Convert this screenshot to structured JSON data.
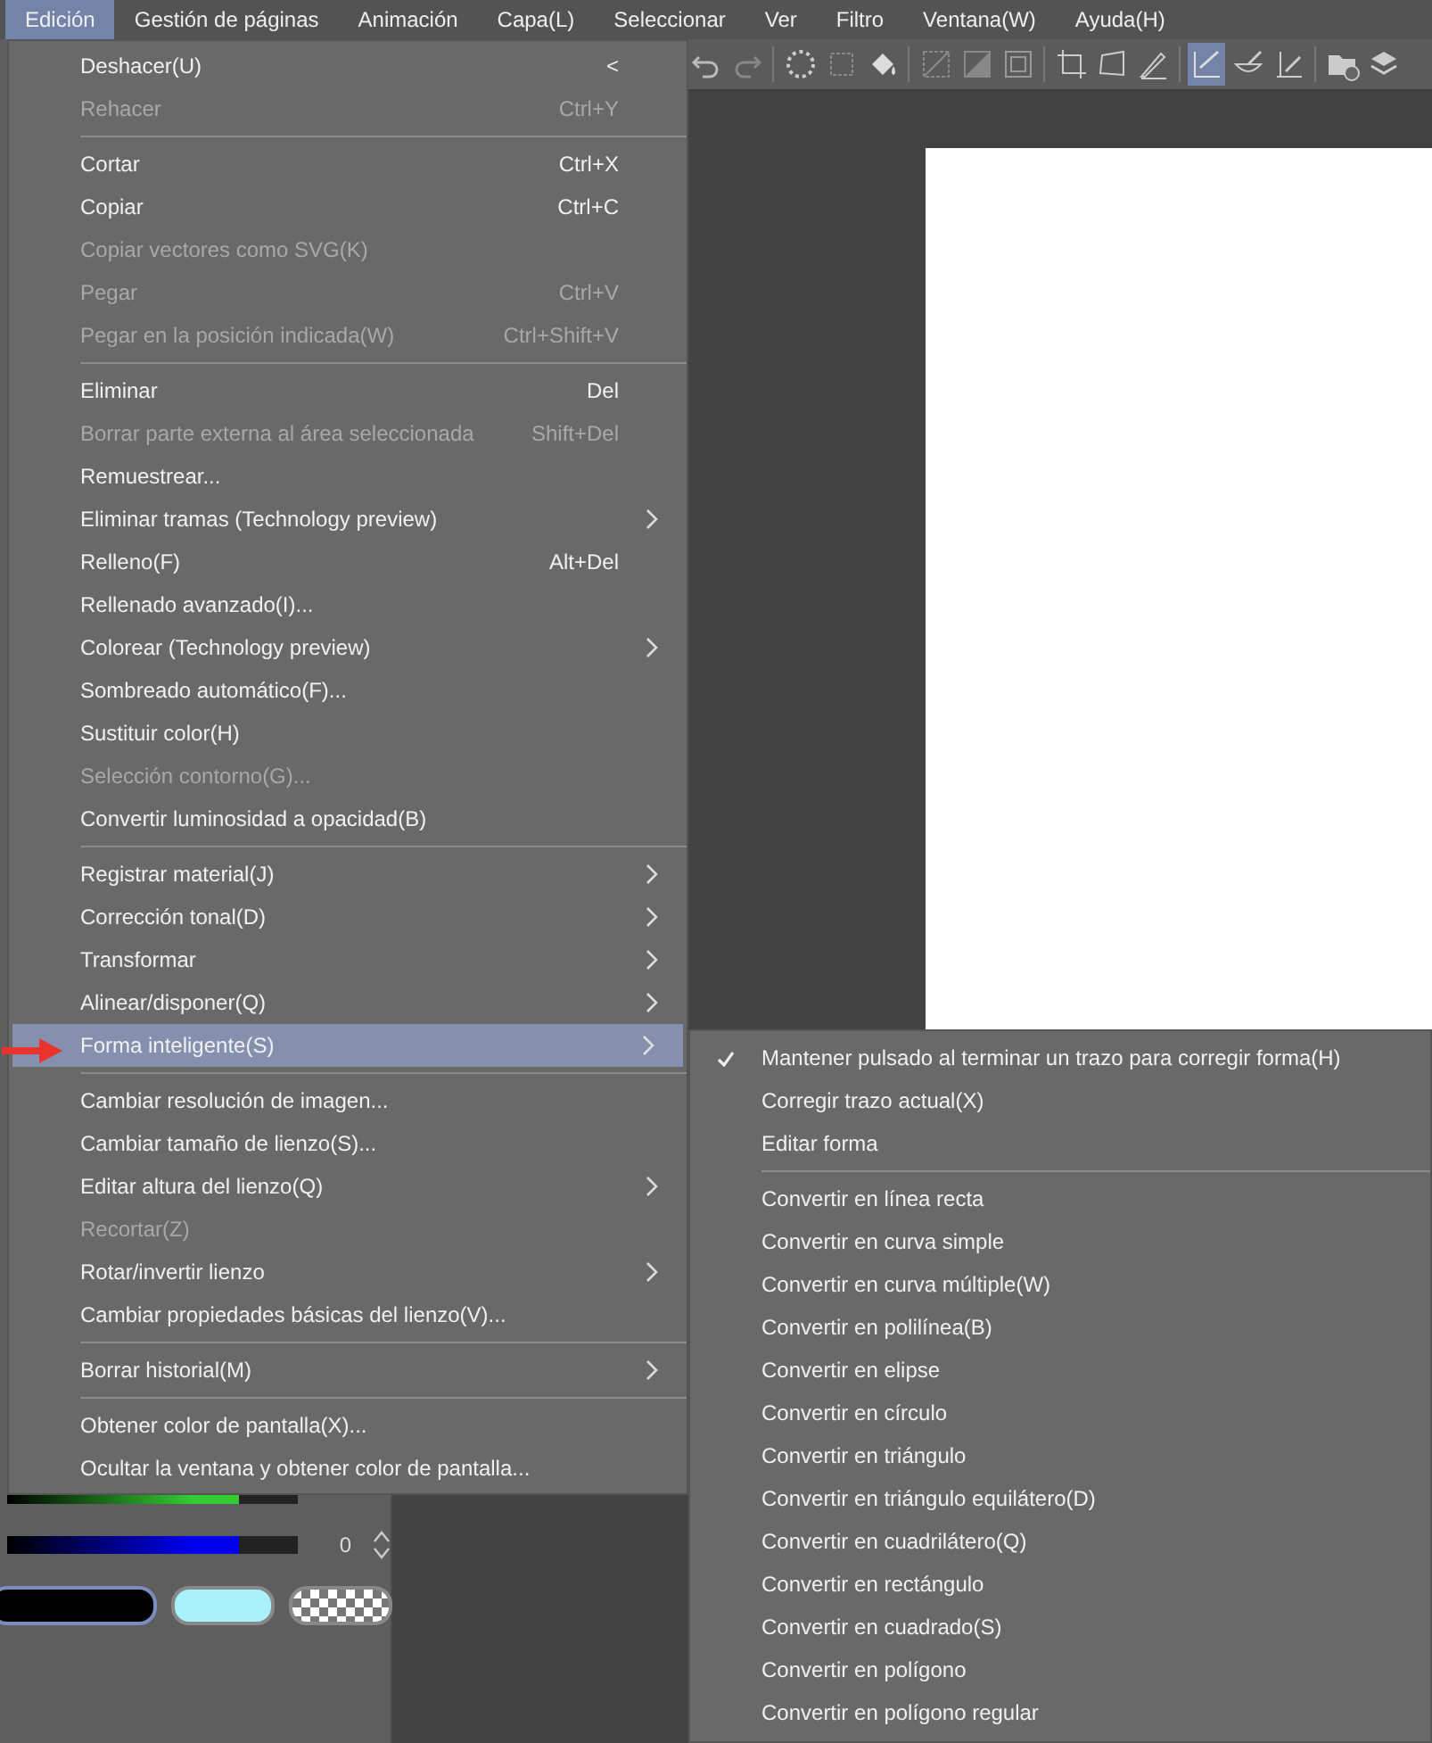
{
  "menu_bar": [
    {
      "label": "Edición",
      "selected": true
    },
    {
      "label": "Gestión de páginas",
      "selected": false
    },
    {
      "label": "Animación",
      "selected": false
    },
    {
      "label": "Capa(L)",
      "selected": false
    },
    {
      "label": "Seleccionar",
      "selected": false
    },
    {
      "label": "Ver",
      "selected": false
    },
    {
      "label": "Filtro",
      "selected": false
    },
    {
      "label": "Ventana(W)",
      "selected": false
    },
    {
      "label": "Ayuda(H)",
      "selected": false
    }
  ],
  "toolbar_buttons": [
    {
      "selected": false
    },
    {
      "selected": false
    },
    {
      "selected": false
    },
    {
      "selected": false
    },
    {
      "selected": false
    },
    {
      "selected": false
    },
    {
      "selected": false
    },
    {
      "selected": false
    },
    {
      "selected": false
    },
    {
      "selected": false
    },
    {
      "selected": false
    },
    {
      "selected": true
    },
    {
      "selected": false
    },
    {
      "selected": false
    },
    {
      "selected": false
    },
    {
      "selected": false
    }
  ],
  "edit_menu": [
    {
      "kind": "item",
      "label": "Deshacer(U)",
      "shortcut": "<",
      "disabled": false,
      "submenu": false,
      "selected": false
    },
    {
      "kind": "item",
      "label": "Rehacer",
      "shortcut": "Ctrl+Y",
      "disabled": true,
      "submenu": false,
      "selected": false
    },
    {
      "kind": "separator"
    },
    {
      "kind": "item",
      "label": "Cortar",
      "shortcut": "Ctrl+X",
      "disabled": false,
      "submenu": false,
      "selected": false
    },
    {
      "kind": "item",
      "label": "Copiar",
      "shortcut": "Ctrl+C",
      "disabled": false,
      "submenu": false,
      "selected": false
    },
    {
      "kind": "item",
      "label": "Copiar vectores como SVG(K)",
      "disabled": true,
      "submenu": false,
      "selected": false
    },
    {
      "kind": "item",
      "label": "Pegar",
      "shortcut": "Ctrl+V",
      "disabled": true,
      "submenu": false,
      "selected": false
    },
    {
      "kind": "item",
      "label": "Pegar en la posición indicada(W)",
      "shortcut": "Ctrl+Shift+V",
      "disabled": true,
      "submenu": false,
      "selected": false
    },
    {
      "kind": "separator"
    },
    {
      "kind": "item",
      "label": "Eliminar",
      "shortcut": "Del",
      "disabled": false,
      "submenu": false,
      "selected": false
    },
    {
      "kind": "item",
      "label": "Borrar parte externa al área seleccionada",
      "shortcut": "Shift+Del",
      "disabled": true,
      "submenu": false,
      "selected": false
    },
    {
      "kind": "item",
      "label": "Remuestrear...",
      "disabled": false,
      "submenu": false,
      "selected": false
    },
    {
      "kind": "item",
      "label": "Eliminar tramas (Technology preview)",
      "disabled": false,
      "submenu": true,
      "selected": false
    },
    {
      "kind": "item",
      "label": "Relleno(F)",
      "shortcut": "Alt+Del",
      "disabled": false,
      "submenu": false,
      "selected": false
    },
    {
      "kind": "item",
      "label": "Rellenado avanzado(I)...",
      "disabled": false,
      "submenu": false,
      "selected": false
    },
    {
      "kind": "item",
      "label": "Colorear (Technology preview)",
      "disabled": false,
      "submenu": true,
      "selected": false
    },
    {
      "kind": "item",
      "label": "Sombreado automático(F)...",
      "disabled": false,
      "submenu": false,
      "selected": false
    },
    {
      "kind": "item",
      "label": "Sustituir color(H)",
      "disabled": false,
      "submenu": false,
      "selected": false
    },
    {
      "kind": "item",
      "label": "Selección contorno(G)...",
      "disabled": true,
      "submenu": false,
      "selected": false
    },
    {
      "kind": "item",
      "label": "Convertir luminosidad a opacidad(B)",
      "disabled": false,
      "submenu": false,
      "selected": false
    },
    {
      "kind": "separator"
    },
    {
      "kind": "item",
      "label": "Registrar material(J)",
      "disabled": false,
      "submenu": true,
      "selected": false
    },
    {
      "kind": "item",
      "label": "Corrección tonal(D)",
      "disabled": false,
      "submenu": true,
      "selected": false
    },
    {
      "kind": "item",
      "label": "Transformar",
      "disabled": false,
      "submenu": true,
      "selected": false
    },
    {
      "kind": "item",
      "label": "Alinear/disponer(Q)",
      "disabled": false,
      "submenu": true,
      "selected": false
    },
    {
      "kind": "item",
      "label": "Forma inteligente(S)",
      "disabled": false,
      "submenu": true,
      "selected": true
    },
    {
      "kind": "separator"
    },
    {
      "kind": "item",
      "label": "Cambiar resolución de imagen...",
      "disabled": false,
      "submenu": false,
      "selected": false
    },
    {
      "kind": "item",
      "label": "Cambiar tamaño de lienzo(S)...",
      "disabled": false,
      "submenu": false,
      "selected": false
    },
    {
      "kind": "item",
      "label": "Editar altura del lienzo(Q)",
      "disabled": false,
      "submenu": true,
      "selected": false
    },
    {
      "kind": "item",
      "label": "Recortar(Z)",
      "disabled": true,
      "submenu": false,
      "selected": false
    },
    {
      "kind": "item",
      "label": "Rotar/invertir lienzo",
      "disabled": false,
      "submenu": true,
      "selected": false
    },
    {
      "kind": "item",
      "label": "Cambiar propiedades básicas del lienzo(V)...",
      "disabled": false,
      "submenu": false,
      "selected": false
    },
    {
      "kind": "separator"
    },
    {
      "kind": "item",
      "label": "Borrar historial(M)",
      "disabled": false,
      "submenu": true,
      "selected": false
    },
    {
      "kind": "separator"
    },
    {
      "kind": "item",
      "label": "Obtener color de pantalla(X)...",
      "disabled": false,
      "submenu": false,
      "selected": false
    },
    {
      "kind": "item",
      "label": "Ocultar la ventana y obtener color de pantalla...",
      "disabled": false,
      "submenu": false,
      "selected": false
    }
  ],
  "smart_shape_submenu": [
    {
      "kind": "item",
      "label": "Mantener pulsado al terminar un trazo para corregir forma(H)",
      "checked": true
    },
    {
      "kind": "item",
      "label": "Corregir trazo actual(X)",
      "checked": false
    },
    {
      "kind": "item",
      "label": "Editar forma",
      "checked": false
    },
    {
      "kind": "separator"
    },
    {
      "kind": "item",
      "label": "Convertir en línea recta",
      "checked": false
    },
    {
      "kind": "item",
      "label": "Convertir en curva simple",
      "checked": false
    },
    {
      "kind": "item",
      "label": "Convertir en curva múltiple(W)",
      "checked": false
    },
    {
      "kind": "item",
      "label": "Convertir en polilínea(B)",
      "checked": false
    },
    {
      "kind": "item",
      "label": "Convertir en elipse",
      "checked": false
    },
    {
      "kind": "item",
      "label": "Convertir en círculo",
      "checked": false
    },
    {
      "kind": "item",
      "label": "Convertir en triángulo",
      "checked": false
    },
    {
      "kind": "item",
      "label": "Convertir en triángulo equilátero(D)",
      "checked": false
    },
    {
      "kind": "item",
      "label": "Convertir en cuadrilátero(Q)",
      "checked": false
    },
    {
      "kind": "item",
      "label": "Convertir en rectángulo",
      "checked": false
    },
    {
      "kind": "item",
      "label": "Convertir en cuadrado(S)",
      "checked": false
    },
    {
      "kind": "item",
      "label": "Convertir en polígono",
      "checked": false
    },
    {
      "kind": "item",
      "label": "Convertir en polígono regular",
      "checked": false
    }
  ],
  "color_sliders": [
    {
      "color": "#33cc33",
      "level": 0.8
    },
    {
      "color": "#0000ee",
      "level": 0.8,
      "value": "0"
    }
  ],
  "color_swatches": [
    {
      "color": "#000000",
      "selected": true
    },
    {
      "color": "#aaf2fb",
      "selected": false
    },
    {
      "kind": "transparent",
      "selected": false
    }
  ]
}
